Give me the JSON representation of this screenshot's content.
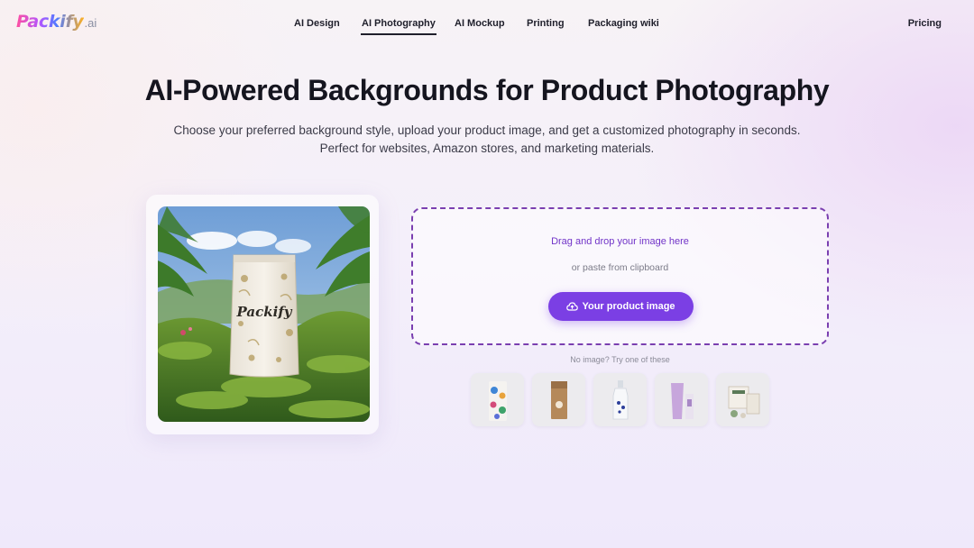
{
  "brand": {
    "name": "Packify",
    "suffix": ".ai"
  },
  "nav": {
    "links": [
      "AI Design",
      "AI Photography",
      "AI Mockup",
      "Printing",
      "Packaging wiki"
    ],
    "active": "AI Photography",
    "pricing": "Pricing"
  },
  "hero": {
    "title": "AI-Powered Backgrounds for Product Photography",
    "subtitle": "Choose your preferred background style, upload your product image, and get a customized photography in seconds. Perfect for websites, Amazon stores, and marketing materials."
  },
  "preview": {
    "pouch_label": "Packify"
  },
  "upload": {
    "drag_text": "Drag and drop your image here",
    "paste_text": "or paste from clipboard",
    "button_label": "Your product image",
    "no_image_text": "No image? Try one of these"
  },
  "samples": [
    {
      "name": "floral-bag"
    },
    {
      "name": "kraft-box"
    },
    {
      "name": "bottle"
    },
    {
      "name": "cosmetic-tube"
    },
    {
      "name": "package-set"
    }
  ],
  "colors": {
    "accent": "#7b3fe4",
    "dash_border": "#7a3fb0",
    "text_dark": "#15151f"
  }
}
